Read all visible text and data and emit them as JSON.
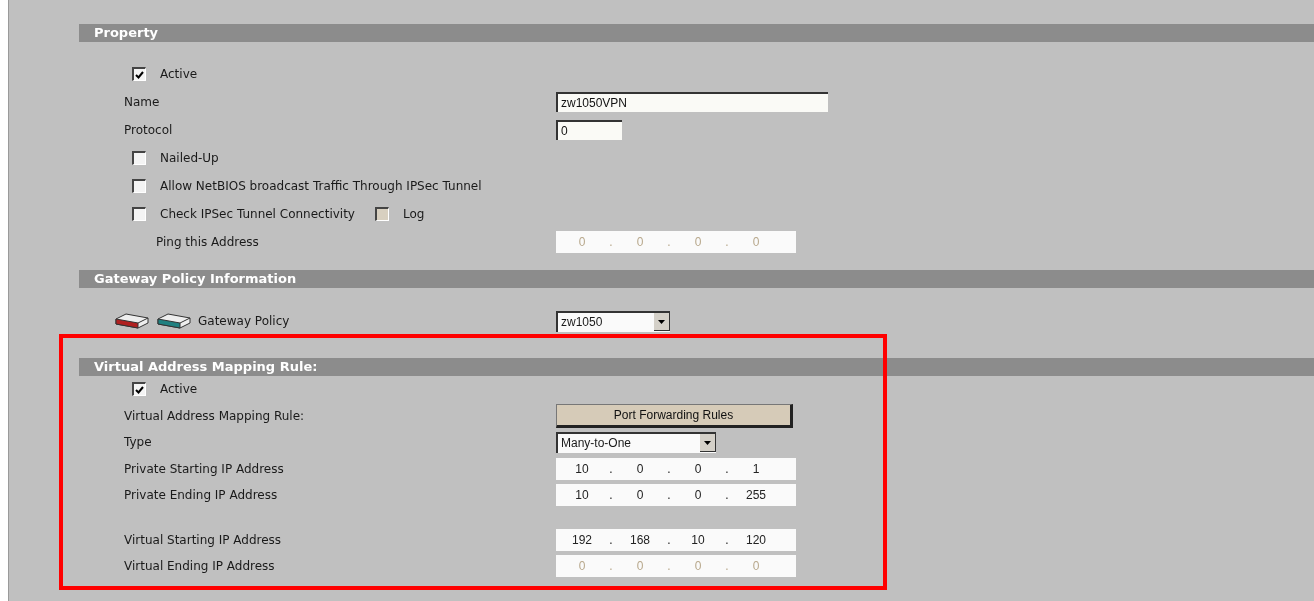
{
  "sections": [
    {
      "title": "Property",
      "highlighted": false,
      "rows": [
        {
          "kind": "checkbox",
          "label": "Active",
          "checked": true
        },
        {
          "kind": "text",
          "label": "Name",
          "value": "zw1050VPN"
        },
        {
          "kind": "number",
          "label": "Protocol",
          "value": "0"
        },
        {
          "kind": "checkbox",
          "label": "Nailed-Up",
          "checked": false
        },
        {
          "kind": "checkbox",
          "label": "Allow NetBIOS broadcast Traffic Through IPSec Tunnel",
          "checked": false
        },
        {
          "kind": "checkbox",
          "label": "Check IPSec Tunnel Connectivity",
          "checked": false,
          "extra": {
            "label": "Log",
            "checked": false,
            "disabled": true
          }
        },
        {
          "kind": "indented-ip",
          "label": "Ping this Address",
          "octets": [
            "0",
            "0",
            "0",
            "0"
          ],
          "separator": ".",
          "disabled": true
        }
      ]
    },
    {
      "title": "Gateway Policy Information",
      "highlighted": false,
      "rows": [
        {
          "kind": "gateway-select",
          "label": "Gateway Policy",
          "value": "zw1050"
        }
      ]
    },
    {
      "title": "Virtual Address Mapping Rule:",
      "highlighted": true,
      "rows": [
        {
          "kind": "checkbox",
          "label": "Active",
          "checked": true
        },
        {
          "kind": "button",
          "label": "Virtual Address Mapping Rule:",
          "button": "Port Forwarding Rules"
        },
        {
          "kind": "select",
          "label": "Type",
          "value": "Many-to-One"
        },
        {
          "kind": "ip",
          "label": "Private Starting IP Address",
          "octets": [
            "10",
            "0",
            "0",
            "1"
          ],
          "separator": ".",
          "disabled": false
        },
        {
          "kind": "ip",
          "label": "Private Ending IP Address",
          "octets": [
            "10",
            "0",
            "0",
            "255"
          ],
          "separator": ".",
          "disabled": false
        },
        {
          "kind": "spacer"
        },
        {
          "kind": "ip",
          "label": "Virtual Starting IP Address",
          "octets": [
            "192",
            "168",
            "10",
            "120"
          ],
          "separator": ".",
          "disabled": false
        },
        {
          "kind": "ip",
          "label": "Virtual Ending IP Address",
          "octets": [
            "0",
            "0",
            "0",
            "0"
          ],
          "separator": ".",
          "disabled": true
        }
      ]
    }
  ]
}
